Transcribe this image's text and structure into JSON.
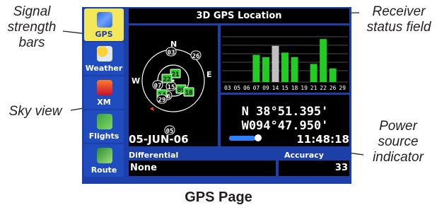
{
  "callouts": {
    "signal_strength_bars": [
      "Signal",
      "strength",
      "bars"
    ],
    "receiver_status_field": [
      "Receiver",
      "status field"
    ],
    "sky_view": "Sky view",
    "power_source_indicator": [
      "Power",
      "source",
      "indicator"
    ]
  },
  "caption": "GPS Page",
  "device": {
    "sidebar": {
      "items": [
        {
          "label": "GPS",
          "icon": "satellite-icon",
          "active": true
        },
        {
          "label": "Weather",
          "icon": "weather-icon",
          "active": false
        },
        {
          "label": "XM",
          "icon": "xm-radio-icon",
          "active": false
        },
        {
          "label": "Flights",
          "icon": "flights-icon",
          "active": false
        },
        {
          "label": "Route",
          "icon": "route-icon",
          "active": false
        }
      ]
    },
    "header": {
      "title": "3D GPS Location"
    },
    "sky_view": {
      "cardinals": {
        "n": "N",
        "e": "E",
        "w": "W"
      },
      "satellites": [
        {
          "id": "03",
          "locked": false
        },
        {
          "id": "05",
          "locked": false
        },
        {
          "id": "06",
          "locked": false
        },
        {
          "id": "07",
          "locked": false
        },
        {
          "id": "09",
          "locked": true
        },
        {
          "id": "14",
          "locked": true
        },
        {
          "id": "15",
          "locked": false
        },
        {
          "id": "18",
          "locked": true
        },
        {
          "id": "21",
          "locked": true
        },
        {
          "id": "22",
          "locked": true
        },
        {
          "id": "26",
          "locked": false
        },
        {
          "id": "29",
          "locked": false
        }
      ]
    },
    "signal_bars": {
      "labels": [
        "03",
        "05",
        "06",
        "07",
        "09",
        "14",
        "15",
        "18",
        "19",
        "21",
        "22",
        "26",
        "29"
      ],
      "levels": [
        0,
        0,
        0,
        0.6,
        0.55,
        0.8,
        0.65,
        0.55,
        0,
        0.4,
        0.95,
        0.3,
        0
      ],
      "status": [
        "none",
        "none",
        "none",
        "locked",
        "locked",
        "searching",
        "locked",
        "locked",
        "none",
        "locked",
        "locked",
        "locked",
        "none"
      ]
    },
    "position": {
      "lat": "N  38°51.395'",
      "lon": "W094°47.950'"
    },
    "date": "05-JUN-06",
    "time": "11:48:18",
    "power_level": 0.8,
    "differential": {
      "label": "Differential",
      "value": "None"
    },
    "accuracy": {
      "label": "Accuracy",
      "value": "33"
    },
    "colors": {
      "locked": "#22cc22",
      "searching": "#c0c0c0",
      "screen": "#1d3fa8",
      "active_tab": "#f2e85a"
    }
  }
}
